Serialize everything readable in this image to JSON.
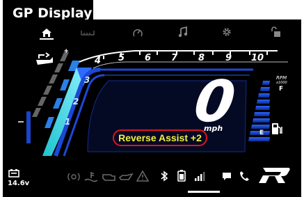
{
  "header": {
    "title": "GP Display"
  },
  "top_icons": [
    "home-icon",
    "battery-bars-icon",
    "gauge-icon",
    "music-icon",
    "settings-gear-icon",
    "lock-icon"
  ],
  "tachometer": {
    "tick_labels": [
      "4",
      "5",
      "6",
      "7",
      "8",
      "9",
      "10"
    ],
    "unit": "RPM",
    "multiplier": "x1000"
  },
  "gears": {
    "labels": [
      "1",
      "2",
      "3"
    ]
  },
  "speed": {
    "value": "0",
    "unit": "mph"
  },
  "fuel": {
    "full_label": "F",
    "empty_label": "E",
    "level_fraction": 1.0
  },
  "notification": {
    "text": "Reverse Assist +2"
  },
  "battery": {
    "voltage": "14.6v"
  },
  "status_icons": [
    "abs-icon",
    "coolant-temp-icon",
    "engine-check-icon",
    "oil-pressure-icon",
    "warning-triangle-icon",
    "bluetooth-icon",
    "phone-battery-icon",
    "signal-strength-icon",
    "message-icon",
    "phone-icon",
    "r-logo-icon"
  ],
  "colors": {
    "accent_cyan": "#32c8e8",
    "accent_blue": "#1b4bcf",
    "badge_border": "#e2131a",
    "badge_text": "#f6ee3c"
  }
}
